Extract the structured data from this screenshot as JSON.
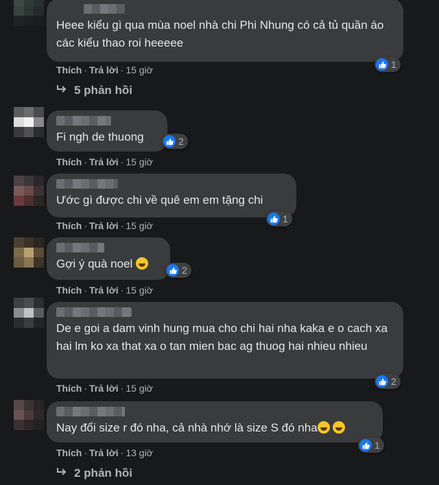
{
  "comments": [
    {
      "text": "Heee kiểu gì qua mùa noel nhà chi Phi Nhung có cả tủ quần áo các kiểu thao roi heeeee",
      "reaction_count": "1",
      "like": "Thích",
      "reply": "Trả lời",
      "time": "15 giờ",
      "replies": "5 phản hồi"
    },
    {
      "text": "Fi ngh de thuong",
      "reaction_count": "2",
      "like": "Thích",
      "reply": "Trả lời",
      "time": "15 giờ"
    },
    {
      "text": "Ước gì được chi về quê em em tặng chi",
      "reaction_count": "1",
      "like": "Thích",
      "reply": "Trả lời",
      "time": "15 giờ"
    },
    {
      "text": "Gợi ý quà noel",
      "reaction_count": "2",
      "like": "Thích",
      "reply": "Trả lời",
      "time": "15 giờ"
    },
    {
      "text": "De e goi a dam vinh hung mua cho chi hai nha kaka e o cach xa hai lm ko xa that xa o tan mien bac ag thuog hai nhieu nhieu",
      "reaction_count": "2",
      "like": "Thích",
      "reply": "Trả lời",
      "time": "15 giờ"
    },
    {
      "text": "Nay đổi size r đó nha, cả nhà nhớ là size S đó nha",
      "reaction_count": "1",
      "like": "Thích",
      "reply": "Trả lời",
      "time": "13 giờ",
      "replies": "2 phản hồi"
    }
  ],
  "colors": {
    "background": "#18191a",
    "bubble": "#3a3b3c",
    "like_blue": "#1877f2",
    "meta_text": "#b0b3b8"
  },
  "icons": {
    "like": "thumbs-up-icon",
    "reply_arrow": "reply-arrow-icon",
    "laugh": "laughing-emoji-icon",
    "grin": "grinning-emoji-icon"
  }
}
